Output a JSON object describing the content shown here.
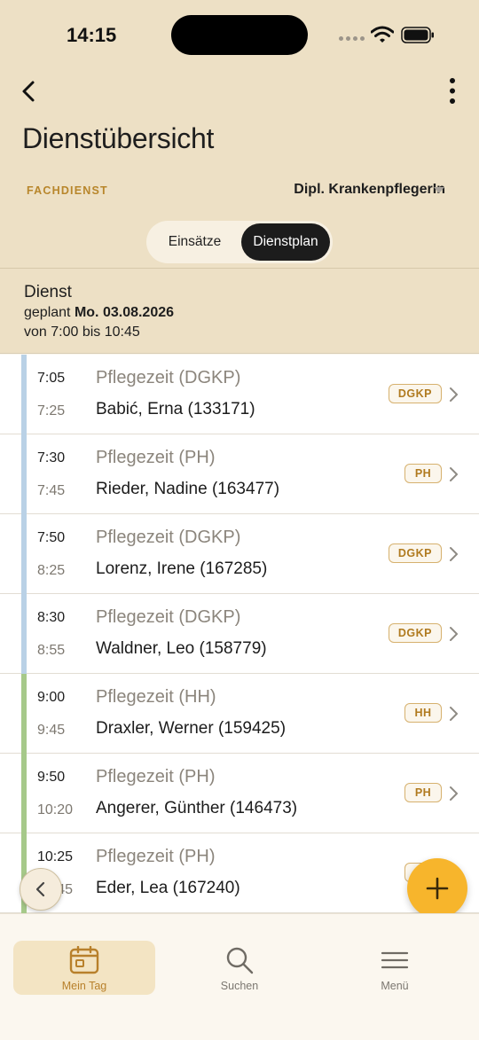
{
  "status_bar": {
    "time": "14:15"
  },
  "header": {
    "title": "Dienstübersicht",
    "role_label": "FACHDIENST",
    "role_value": "Dipl. KrankenpflegerIn"
  },
  "segmented": {
    "options": [
      "Einsätze",
      "Dienstplan"
    ],
    "selected": "Dienstplan"
  },
  "dienst": {
    "title": "Dienst",
    "planned_prefix": "geplant",
    "planned_date": "Mo. 03.08.2026",
    "time_range": "von 7:00 bis 10:45"
  },
  "rows": [
    {
      "start": "7:05",
      "end": "7:25",
      "service": "Pflegezeit (DGKP)",
      "patient": "Babić, Erna (133171)",
      "badge": "DGKP",
      "bar_color": "#b9d1e6"
    },
    {
      "start": "7:30",
      "end": "7:45",
      "service": "Pflegezeit (PH)",
      "patient": "Rieder, Nadine (163477)",
      "badge": "PH",
      "bar_color": "#b9d1e6"
    },
    {
      "start": "7:50",
      "end": "8:25",
      "service": "Pflegezeit (DGKP)",
      "patient": "Lorenz, Irene (167285)",
      "badge": "DGKP",
      "bar_color": "#b9d1e6"
    },
    {
      "start": "8:30",
      "end": "8:55",
      "service": "Pflegezeit (DGKP)",
      "patient": "Waldner, Leo (158779)",
      "badge": "DGKP",
      "bar_color": "#b9d1e6"
    },
    {
      "start": "9:00",
      "end": "9:45",
      "service": "Pflegezeit (HH)",
      "patient": "Draxler, Werner (159425)",
      "badge": "HH",
      "bar_color": "#a6c98a"
    },
    {
      "start": "9:50",
      "end": "10:20",
      "service": "Pflegezeit (PH)",
      "patient": "Angerer, Günther (146473)",
      "badge": "PH",
      "bar_color": "#a6c98a"
    },
    {
      "start": "10:25",
      "end": "10:45",
      "service": "Pflegezeit (PH)",
      "patient": "Eder, Lea (167240)",
      "badge": "PH",
      "bar_color": "#a6c98a"
    }
  ],
  "tab_bar": {
    "items": [
      {
        "label": "Mein Tag",
        "icon": "calendar-icon",
        "active": true
      },
      {
        "label": "Suchen",
        "icon": "search-icon",
        "active": false
      },
      {
        "label": "Menü",
        "icon": "menu-icon",
        "active": false
      }
    ]
  },
  "colors": {
    "accent": "#f7b52c",
    "header_bg": "#ede0c5",
    "brand_text": "#b8862b"
  }
}
